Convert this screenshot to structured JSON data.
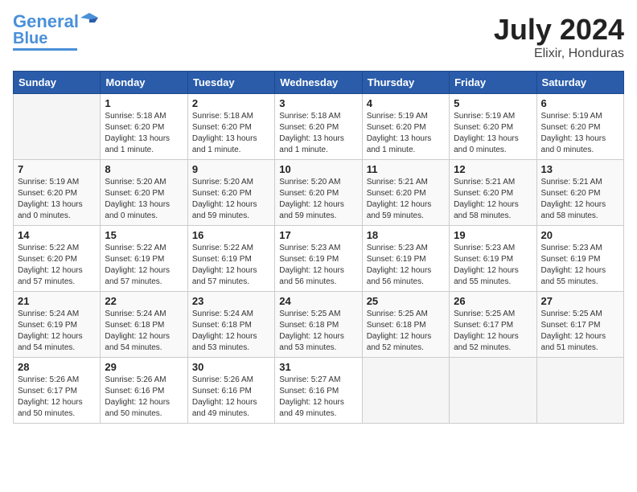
{
  "header": {
    "logo_line1": "General",
    "logo_line2": "Blue",
    "title": "July 2024",
    "location": "Elixir, Honduras"
  },
  "weekdays": [
    "Sunday",
    "Monday",
    "Tuesday",
    "Wednesday",
    "Thursday",
    "Friday",
    "Saturday"
  ],
  "weeks": [
    [
      {
        "day": "",
        "info": ""
      },
      {
        "day": "1",
        "info": "Sunrise: 5:18 AM\nSunset: 6:20 PM\nDaylight: 13 hours\nand 1 minute."
      },
      {
        "day": "2",
        "info": "Sunrise: 5:18 AM\nSunset: 6:20 PM\nDaylight: 13 hours\nand 1 minute."
      },
      {
        "day": "3",
        "info": "Sunrise: 5:18 AM\nSunset: 6:20 PM\nDaylight: 13 hours\nand 1 minute."
      },
      {
        "day": "4",
        "info": "Sunrise: 5:19 AM\nSunset: 6:20 PM\nDaylight: 13 hours\nand 1 minute."
      },
      {
        "day": "5",
        "info": "Sunrise: 5:19 AM\nSunset: 6:20 PM\nDaylight: 13 hours\nand 0 minutes."
      },
      {
        "day": "6",
        "info": "Sunrise: 5:19 AM\nSunset: 6:20 PM\nDaylight: 13 hours\nand 0 minutes."
      }
    ],
    [
      {
        "day": "7",
        "info": "Sunrise: 5:19 AM\nSunset: 6:20 PM\nDaylight: 13 hours\nand 0 minutes."
      },
      {
        "day": "8",
        "info": "Sunrise: 5:20 AM\nSunset: 6:20 PM\nDaylight: 13 hours\nand 0 minutes."
      },
      {
        "day": "9",
        "info": "Sunrise: 5:20 AM\nSunset: 6:20 PM\nDaylight: 12 hours\nand 59 minutes."
      },
      {
        "day": "10",
        "info": "Sunrise: 5:20 AM\nSunset: 6:20 PM\nDaylight: 12 hours\nand 59 minutes."
      },
      {
        "day": "11",
        "info": "Sunrise: 5:21 AM\nSunset: 6:20 PM\nDaylight: 12 hours\nand 59 minutes."
      },
      {
        "day": "12",
        "info": "Sunrise: 5:21 AM\nSunset: 6:20 PM\nDaylight: 12 hours\nand 58 minutes."
      },
      {
        "day": "13",
        "info": "Sunrise: 5:21 AM\nSunset: 6:20 PM\nDaylight: 12 hours\nand 58 minutes."
      }
    ],
    [
      {
        "day": "14",
        "info": "Sunrise: 5:22 AM\nSunset: 6:20 PM\nDaylight: 12 hours\nand 57 minutes."
      },
      {
        "day": "15",
        "info": "Sunrise: 5:22 AM\nSunset: 6:19 PM\nDaylight: 12 hours\nand 57 minutes."
      },
      {
        "day": "16",
        "info": "Sunrise: 5:22 AM\nSunset: 6:19 PM\nDaylight: 12 hours\nand 57 minutes."
      },
      {
        "day": "17",
        "info": "Sunrise: 5:23 AM\nSunset: 6:19 PM\nDaylight: 12 hours\nand 56 minutes."
      },
      {
        "day": "18",
        "info": "Sunrise: 5:23 AM\nSunset: 6:19 PM\nDaylight: 12 hours\nand 56 minutes."
      },
      {
        "day": "19",
        "info": "Sunrise: 5:23 AM\nSunset: 6:19 PM\nDaylight: 12 hours\nand 55 minutes."
      },
      {
        "day": "20",
        "info": "Sunrise: 5:23 AM\nSunset: 6:19 PM\nDaylight: 12 hours\nand 55 minutes."
      }
    ],
    [
      {
        "day": "21",
        "info": "Sunrise: 5:24 AM\nSunset: 6:19 PM\nDaylight: 12 hours\nand 54 minutes."
      },
      {
        "day": "22",
        "info": "Sunrise: 5:24 AM\nSunset: 6:18 PM\nDaylight: 12 hours\nand 54 minutes."
      },
      {
        "day": "23",
        "info": "Sunrise: 5:24 AM\nSunset: 6:18 PM\nDaylight: 12 hours\nand 53 minutes."
      },
      {
        "day": "24",
        "info": "Sunrise: 5:25 AM\nSunset: 6:18 PM\nDaylight: 12 hours\nand 53 minutes."
      },
      {
        "day": "25",
        "info": "Sunrise: 5:25 AM\nSunset: 6:18 PM\nDaylight: 12 hours\nand 52 minutes."
      },
      {
        "day": "26",
        "info": "Sunrise: 5:25 AM\nSunset: 6:17 PM\nDaylight: 12 hours\nand 52 minutes."
      },
      {
        "day": "27",
        "info": "Sunrise: 5:25 AM\nSunset: 6:17 PM\nDaylight: 12 hours\nand 51 minutes."
      }
    ],
    [
      {
        "day": "28",
        "info": "Sunrise: 5:26 AM\nSunset: 6:17 PM\nDaylight: 12 hours\nand 50 minutes."
      },
      {
        "day": "29",
        "info": "Sunrise: 5:26 AM\nSunset: 6:16 PM\nDaylight: 12 hours\nand 50 minutes."
      },
      {
        "day": "30",
        "info": "Sunrise: 5:26 AM\nSunset: 6:16 PM\nDaylight: 12 hours\nand 49 minutes."
      },
      {
        "day": "31",
        "info": "Sunrise: 5:27 AM\nSunset: 6:16 PM\nDaylight: 12 hours\nand 49 minutes."
      },
      {
        "day": "",
        "info": ""
      },
      {
        "day": "",
        "info": ""
      },
      {
        "day": "",
        "info": ""
      }
    ]
  ]
}
